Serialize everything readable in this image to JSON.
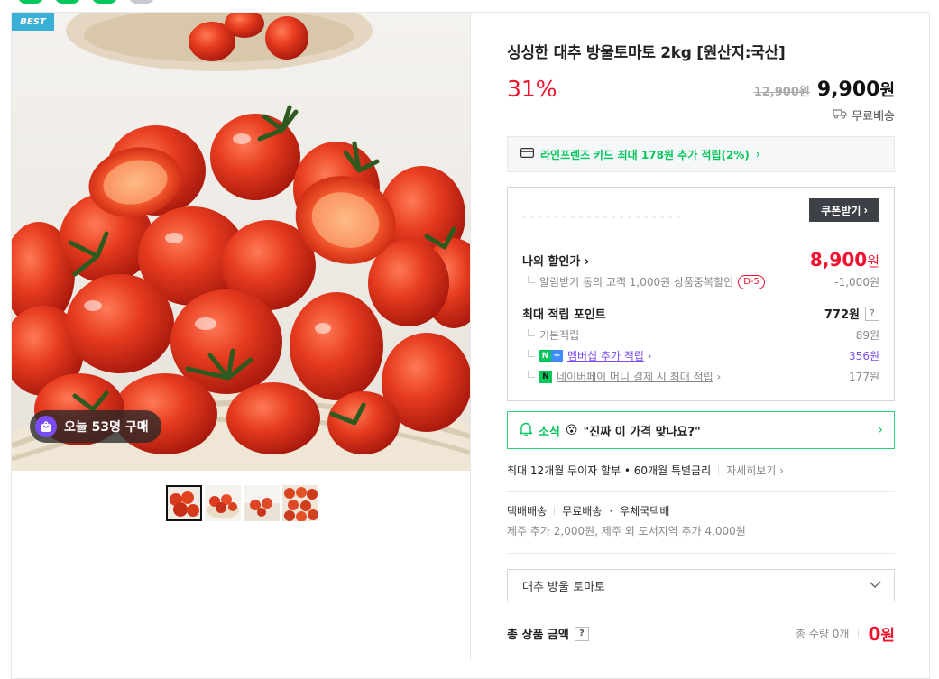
{
  "gallery": {
    "best_badge": "BEST",
    "today_purchase": "오늘 53명 구매"
  },
  "product": {
    "title": "싱싱한 대추 방울토마토 2kg [원산지:국산]",
    "discount_rate": "31%",
    "original_price": "12,900원",
    "sale_price_num": "9,900",
    "sale_price_unit": "원",
    "shipping": "무료배송"
  },
  "card_benefit": {
    "text": "라인프렌즈 카드 최대 178원 추가 적립(2%)",
    "chevron": "›"
  },
  "coupon": {
    "button_label": "쿠폰받기",
    "button_chevron": "›",
    "my_price_label": "나의 할인가",
    "my_price_chevron": "›",
    "my_price_value": "8,900",
    "my_price_unit": "원",
    "alarm_discount_label": "알림받기 동의 고객 1,000원 상품중복할인",
    "alarm_badge": "D-5",
    "alarm_discount_value": "-1,000원",
    "points_label": "최대 적립 포인트",
    "points_value": "772원",
    "help_mark": "?",
    "basic_label": "기본적립",
    "basic_value": "89원",
    "membership_label": "멤버십 추가 적립",
    "membership_chevron": "›",
    "membership_value": "356원",
    "npay_label": "네이버페이 머니 결제 시 최대 적립",
    "npay_chevron": "›",
    "npay_value": "177원",
    "nplus_n": "N",
    "nplus_plus": "+",
    "npay_mark": "N"
  },
  "news": {
    "label": "소식",
    "emoji": "😮",
    "text": "\"진짜 이 가격 맞나요?\"",
    "chevron": "›"
  },
  "installment": {
    "text": "최대 12개월 무이자 할부 • 60개월 특별금리",
    "detail_link": "자세히보기 ›"
  },
  "delivery": {
    "type": "택배배송",
    "fee": "무료배송",
    "carrier": "우체국택배",
    "dot": "·",
    "note": "제주 추가 2,000원, 제주 외 도서지역 추가 4,000원"
  },
  "option_select": {
    "selected": "대추 방울 토마토"
  },
  "total": {
    "label": "총 상품 금액",
    "help_mark": "?",
    "quantity": "총 수량 0개",
    "price_num": "0",
    "price_unit": "원"
  },
  "colors": {
    "brand_green": "#03c75a",
    "sale_red": "#f0122f",
    "best_blue": "#3bb0d6",
    "membership_purple": "#7a4cf4"
  }
}
